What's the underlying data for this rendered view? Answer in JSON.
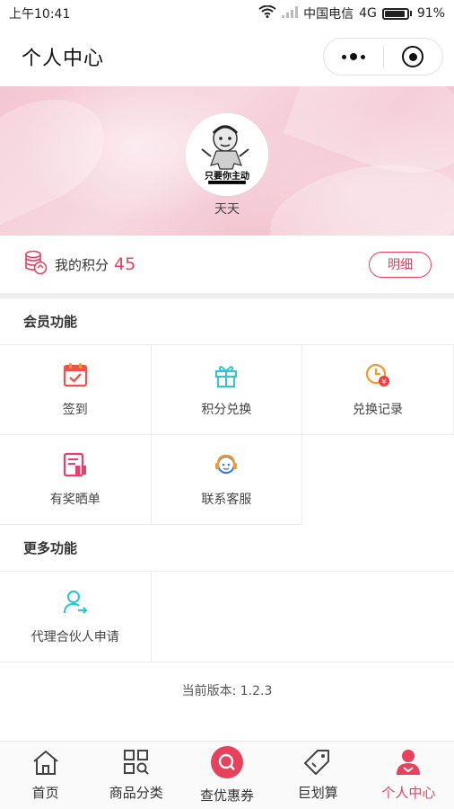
{
  "status_bar": {
    "time": "上午10:41",
    "carrier": "中国电信",
    "network": "4G",
    "battery": "91%",
    "battery_level": 0.91
  },
  "nav": {
    "title": "个人中心"
  },
  "profile": {
    "nickname": "天天",
    "avatar_caption": "只要你主动"
  },
  "points": {
    "label": "我的积分",
    "value": "45",
    "detail_button": "明细"
  },
  "member_section": {
    "title": "会员功能",
    "items": [
      {
        "label": "签到",
        "icon": "calendar-check-icon"
      },
      {
        "label": "积分兑换",
        "icon": "gift-icon"
      },
      {
        "label": "兑换记录",
        "icon": "clock-coin-icon"
      },
      {
        "label": "有奖晒单",
        "icon": "receipt-gift-icon"
      },
      {
        "label": "联系客服",
        "icon": "customer-service-icon"
      }
    ]
  },
  "more_section": {
    "title": "更多功能",
    "items": [
      {
        "label": "代理合伙人申请",
        "icon": "user-arrow-icon"
      }
    ]
  },
  "version": "当前版本: 1.2.3",
  "tab_bar": {
    "items": [
      {
        "label": "首页",
        "icon": "home-icon"
      },
      {
        "label": "商品分类",
        "icon": "category-search-icon"
      },
      {
        "label": "查优惠券",
        "icon": "coupon-search-icon"
      },
      {
        "label": "巨划算",
        "icon": "price-tag-icon"
      },
      {
        "label": "个人中心",
        "icon": "user-icon"
      }
    ],
    "active_index": 4
  },
  "colors": {
    "accent": "#e8415e",
    "calendar": "#f0524a",
    "gift": "#2fc8d2",
    "clock": "#f29a2e",
    "receipt": "#ec3e6b",
    "service": "#3c7de0",
    "partner": "#2fc8d2"
  }
}
